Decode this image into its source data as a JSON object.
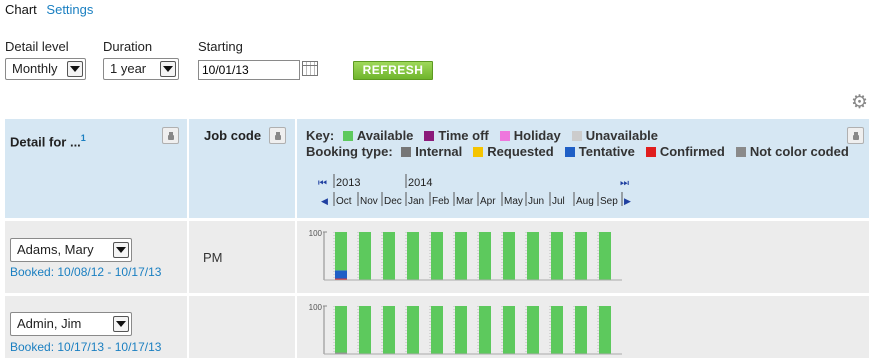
{
  "tabs": {
    "chart": "Chart",
    "settings": "Settings"
  },
  "controls": {
    "detail_level": {
      "label": "Detail level",
      "value": "Monthly"
    },
    "duration": {
      "label": "Duration",
      "value": "1 year"
    },
    "starting": {
      "label": "Starting",
      "value": "10/01/13"
    },
    "refresh_label": "REFRESH"
  },
  "colors": {
    "header_bg": "#d6e7f3",
    "available": "#5dc95d",
    "time_off": "#8b1a7a",
    "holiday": "#ee77dd",
    "unavailable": "#cccccc",
    "internal": "#777777",
    "requested": "#f5c400",
    "tentative": "#1f5fc6",
    "confirmed": "#e01e1e",
    "not_color_coded": "#8a8a8a",
    "refresh_button": "#7cc23a"
  },
  "table_header": {
    "detail_for": "Detail for ...",
    "detail_for_note": "1",
    "job_code": "Job code"
  },
  "key": {
    "label": "Key:",
    "items": [
      {
        "label": "Available",
        "color_key": "available"
      },
      {
        "label": "Time off",
        "color_key": "time_off"
      },
      {
        "label": "Holiday",
        "color_key": "holiday"
      },
      {
        "label": "Unavailable",
        "color_key": "unavailable"
      }
    ]
  },
  "booking_type": {
    "label": "Booking type:",
    "items": [
      {
        "label": "Internal",
        "color_key": "internal"
      },
      {
        "label": "Requested",
        "color_key": "requested"
      },
      {
        "label": "Tentative",
        "color_key": "tentative"
      },
      {
        "label": "Confirmed",
        "color_key": "confirmed"
      },
      {
        "label": "Not color coded",
        "color_key": "not_color_coded"
      }
    ]
  },
  "timeline": {
    "years": [
      "2013",
      "2014"
    ],
    "months": [
      "Oct",
      "Nov",
      "Dec",
      "Jan",
      "Feb",
      "Mar",
      "Apr",
      "May",
      "Jun",
      "Jul",
      "Aug",
      "Sep"
    ],
    "nav_first": "⏮",
    "nav_prev": "◀",
    "nav_next": "▶",
    "nav_last": "⏭"
  },
  "rows": [
    {
      "name": "Adams, Mary",
      "booked": "Booked: 10/08/12 - 10/17/13",
      "job_code": "PM",
      "y_axis_label": "100",
      "chart_data": {
        "type": "bar",
        "categories": [
          "Oct",
          "Nov",
          "Dec",
          "Jan",
          "Feb",
          "Mar",
          "Apr",
          "May",
          "Jun",
          "Jul",
          "Aug",
          "Sep"
        ],
        "ylim": [
          0,
          100
        ],
        "series": [
          {
            "name": "Confirmed",
            "values": [
              3,
              0,
              0,
              0,
              0,
              0,
              0,
              0,
              0,
              0,
              0,
              0
            ]
          },
          {
            "name": "Tentative",
            "values": [
              17,
              0,
              0,
              0,
              0,
              0,
              0,
              0,
              0,
              0,
              0,
              0
            ]
          },
          {
            "name": "Available",
            "values": [
              80,
              100,
              100,
              100,
              100,
              100,
              100,
              100,
              100,
              100,
              100,
              100
            ]
          }
        ]
      }
    },
    {
      "name": "Admin, Jim",
      "booked": "Booked: 10/17/13 - 10/17/13",
      "job_code": "",
      "y_axis_label": "100",
      "chart_data": {
        "type": "bar",
        "categories": [
          "Oct",
          "Nov",
          "Dec",
          "Jan",
          "Feb",
          "Mar",
          "Apr",
          "May",
          "Jun",
          "Jul",
          "Aug",
          "Sep"
        ],
        "ylim": [
          0,
          100
        ],
        "series": [
          {
            "name": "Not color coded",
            "values": [
              3,
              0,
              0,
              0,
              0,
              0,
              0,
              0,
              0,
              0,
              0,
              0
            ]
          },
          {
            "name": "Available",
            "values": [
              97,
              100,
              100,
              100,
              100,
              100,
              100,
              100,
              100,
              100,
              100,
              100
            ]
          }
        ]
      }
    }
  ]
}
